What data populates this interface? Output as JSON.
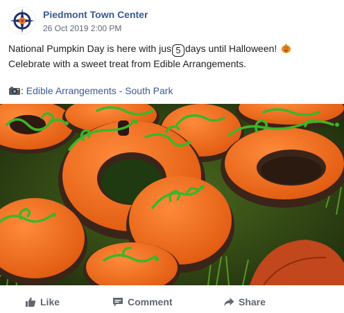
{
  "post": {
    "page_name": "Piedmont Town Center",
    "timestamp": "26 Oct 2019 2:00 PM",
    "text_part1": "National Pumpkin Day is here with jus",
    "countdown_number": "5",
    "text_part2": "days until Halloween! ",
    "text_part3": " Celebrate with a sweet treat from Edible Arrangements.",
    "link_prefix": ": ",
    "link_text": "Edible Arrangements - South Park",
    "emoji_1": "pumpkin-emoji",
    "emoji_2": "camera-emoji"
  },
  "actions": {
    "like_label": "Like",
    "comment_label": "Comment",
    "share_label": "Share"
  },
  "colors": {
    "link": "#385898",
    "text": "#1c1e21",
    "muted": "#606770",
    "frosting_orange": "#f26a1b",
    "vine_green": "#3db52a",
    "chocolate": "#3b2418"
  }
}
